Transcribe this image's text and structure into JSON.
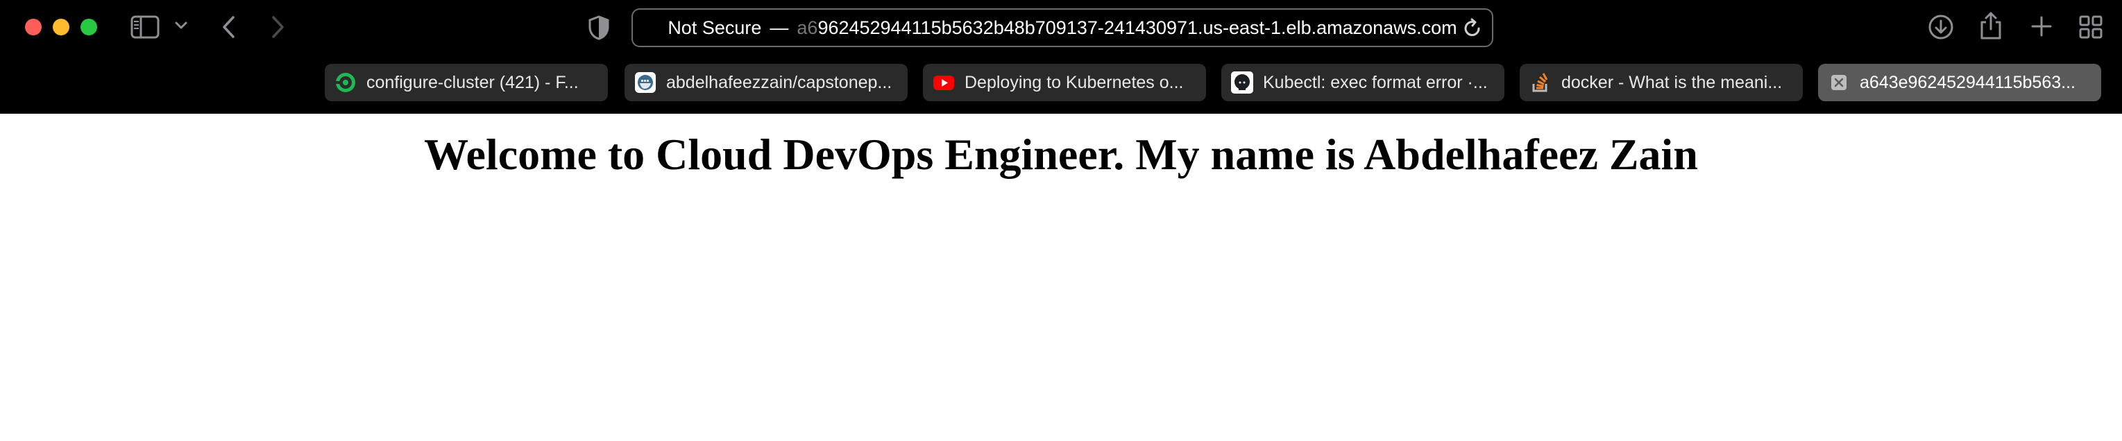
{
  "browser": {
    "address_bar": {
      "security_label": "Not Secure",
      "separator": "—",
      "url_faded": "a6",
      "url_rest": "962452944115b5632b48b709137-241430971.us-east-1.elb.amazonaws.com"
    },
    "tabs": [
      {
        "title": "configure-cluster (421) - F...",
        "icon": "circleci-icon"
      },
      {
        "title": "abdelhafeezzain/capstonep...",
        "icon": "docker-hub-icon"
      },
      {
        "title": "Deploying to Kubernetes o...",
        "icon": "youtube-icon"
      },
      {
        "title": "Kubectl: exec format error ·...",
        "icon": "github-icon"
      },
      {
        "title": "docker - What is the meani...",
        "icon": "stackoverflow-icon"
      },
      {
        "title": "a643e962452944115b563...",
        "icon": "close-icon",
        "active": true
      }
    ]
  },
  "page": {
    "heading": "Welcome to Cloud DevOps Engineer. My name is Abdelhafeez Zain"
  },
  "colors": {
    "toolbar_bg": "#000000",
    "tab_bg": "#2a2a2a",
    "active_tab_bg": "#5a5a5a",
    "close_red": "#ff5f57",
    "minimize_yellow": "#febc2e",
    "maximize_green": "#28c840"
  }
}
